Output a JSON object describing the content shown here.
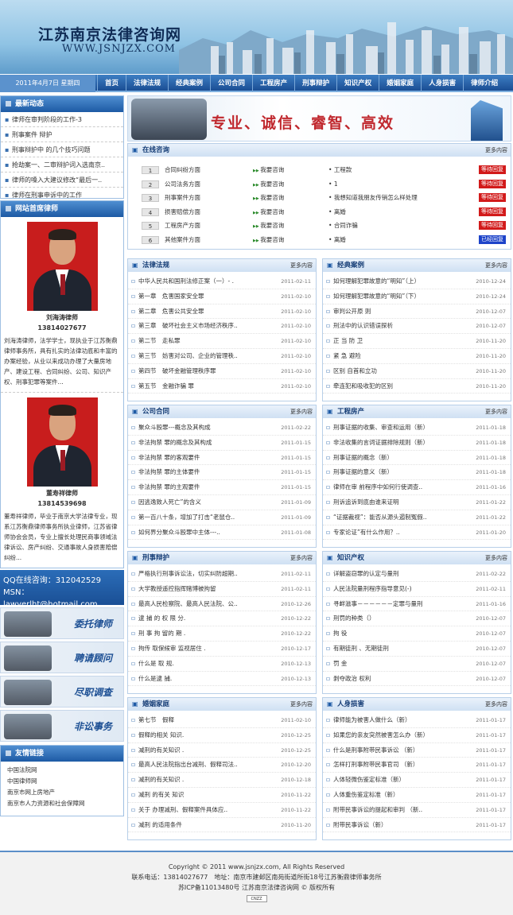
{
  "header": {
    "logo_cn": "江苏南京法律咨询网",
    "logo_url": "WWW.JSNJZX.COM"
  },
  "nav": {
    "date": "2011年4月7日 星期四",
    "items": [
      "首页",
      "法律法规",
      "经典案例",
      "公司合同",
      "工程房产",
      "刑事辩护",
      "知识产权",
      "婚姻家庭",
      "人身损害",
      "律师介绍"
    ]
  },
  "left": {
    "news_title": "最新动态",
    "news": [
      "律师在审判阶段的工作-3",
      "刑事案件 辩护",
      "刑事辩护中 的几个技巧问题",
      "抢劫案一、二审辩护词入选南京..",
      "律师的嗓入大建议修改“最后一..",
      "律师在刑事申诉中的工作"
    ],
    "lawyers_title": "网站首席律师",
    "lawyers": [
      {
        "name": "刘海涛律师",
        "phone": "13814027677",
        "desc": "刘海涛律师，法学学士，现执业于江苏衡鼎律师事务所，具有扎实的法律功底和丰富的办案经验，从业以来成功办理了大量房地产、建设工程、合同纠纷、公司、知识产权、刑事犯罪等案件..."
      },
      {
        "name": "董寿祥律师",
        "phone": "13814539698",
        "desc": "董寿祥律师，毕业于南京大学法律专业，现系江苏衡鼎律师事务所执业律师，江苏省律师协会会员，专业上擅长处理民商事领域法律诉讼、房产纠纷、交通事故人身损害赔偿纠纷..."
      }
    ],
    "qq": "QQ在线咨询：312042529",
    "msn": "MSN：lawyerlht@hotmail.com",
    "services": [
      "委托律师",
      "聘请顾问",
      "尽职调查",
      "非讼事务"
    ],
    "links_title": "友情链接",
    "links": [
      "中国法院网",
      "中国律师网",
      "南京市网上房地产",
      "南京市人力资源和社会保障网"
    ]
  },
  "promo": {
    "slogan": "专业、诚信、睿智、高效"
  },
  "consult": {
    "title": "在线咨询",
    "more": "更多内容",
    "rows": [
      {
        "num": "1",
        "cat": "合同纠纷方面",
        "ask": "我要咨询",
        "q": "工程款",
        "status": "等待回复",
        "done": false
      },
      {
        "num": "2",
        "cat": "公司法务方面",
        "ask": "我要咨询",
        "q": "1",
        "status": "等待回复",
        "done": false
      },
      {
        "num": "3",
        "cat": "刑事案件方面",
        "ask": "我要咨询",
        "q": "我想知道我朋友传销怎么样处理",
        "status": "等待回复",
        "done": false
      },
      {
        "num": "4",
        "cat": "损害赔偿方面",
        "ask": "我要咨询",
        "q": "离婚",
        "status": "等待回复",
        "done": false
      },
      {
        "num": "5",
        "cat": "工程房产方面",
        "ask": "我要咨询",
        "q": "合同诈骗",
        "status": "等待回复",
        "done": false
      },
      {
        "num": "6",
        "cat": "其他案件方面",
        "ask": "我要咨询",
        "q": "离婚",
        "status": "已经回复",
        "done": true
      }
    ]
  },
  "sections": [
    {
      "title": "法律法规",
      "more": "更多内容",
      "items": [
        [
          "中华人民共和国刑法修正案（一）- .",
          "2011-02-11"
        ],
        [
          "第一章　危害国家安全罪",
          "2011-02-10"
        ],
        [
          "第二章　危害公共安全罪",
          "2011-02-10"
        ],
        [
          "第三章　破坏社会主义市场经济秩序..",
          "2011-02-10"
        ],
        [
          "第二节　走私罪",
          "2011-02-10"
        ],
        [
          "第三节　妨害对公司、企业的管理秩..",
          "2011-02-10"
        ],
        [
          "第四节　破坏金融管理秩序罪",
          "2011-02-10"
        ],
        [
          "第五节　金融诈骗 罪",
          "2011-02-10"
        ]
      ]
    },
    {
      "title": "经典案例",
      "more": "更多内容",
      "items": [
        [
          "如何理解犯罪故意的“明知”（上）",
          "2010-12-24"
        ],
        [
          "如何理解犯罪故意的“明知”（下）",
          "2010-12-24"
        ],
        [
          "审判公开原 则",
          "2010-12-07"
        ],
        [
          "刑法中的认识错误探析",
          "2010-12-07"
        ],
        [
          "正 当 防 卫",
          "2010-11-20"
        ],
        [
          "紧 急 避险",
          "2010-11-20"
        ],
        [
          "区别 自首和立功",
          "2010-11-20"
        ],
        [
          "牵连犯和吸收犯的区别",
          "2010-11-20"
        ]
      ]
    },
    {
      "title": "公司合同",
      "more": "更多内容",
      "items": [
        [
          "聚众斗殴罪---概念及其构成",
          "2011-02-22"
        ],
        [
          "非法拘禁 罪的概念及其构成",
          "2011-01-15"
        ],
        [
          "非法拘禁 罪的客观要件",
          "2011-01-15"
        ],
        [
          "非法拘禁 罪的主体要件",
          "2011-01-15"
        ],
        [
          "非法拘禁 罪的主观要件",
          "2011-01-15"
        ],
        [
          "因逃逸致人死亡”的含义",
          "2011-01-09"
        ],
        [
          "第一百八十条，增加了打击“老鼠仓..",
          "2011-01-09"
        ],
        [
          "如何界分聚众斗殴罪中主体---..",
          "2011-01-08"
        ]
      ]
    },
    {
      "title": "工程房产",
      "more": "更多内容",
      "items": [
        [
          "刑事证据的收集、审查和运用（新）",
          "2011-01-18"
        ],
        [
          "非法收集的言词证据排除规则（新）",
          "2011-01-18"
        ],
        [
          "刑事证据的概念（新）",
          "2011-01-18"
        ],
        [
          "刑事证据的意义（新）",
          "2011-01-18"
        ],
        [
          "律师在审 前程序中如何行使调查..",
          "2011-01-16"
        ],
        [
          "刑诉追诉到底由谁来证明",
          "2011-01-22"
        ],
        [
          "“证据裁视”：能否从源头遏制冤假..",
          "2011-01-22"
        ],
        [
          "专家论证”有什么作用？..",
          "2011-01-20"
        ]
      ]
    },
    {
      "title": "刑事辩护",
      "more": "更多内容",
      "items": [
        [
          "严格执行刑事诉讼法，切实纠防超期..",
          "2011-02-11"
        ],
        [
          "大学教授遥控指挥赌博被拘留",
          "2011-02-11"
        ],
        [
          "最高人民检察院、最高人民法院、公..",
          "2010-12-26"
        ],
        [
          "逮 捕 的 权 限 分.",
          "2010-12-22"
        ],
        [
          "刑 事 拘 留的 期 .",
          "2010-12-22"
        ],
        [
          "拘传 取保候审 监视居住 .",
          "2010-12-17"
        ],
        [
          "什么是 取 规.",
          "2010-12-13"
        ],
        [
          "什么是逮 捕.",
          "2010-12-13"
        ]
      ]
    },
    {
      "title": "知识产权",
      "more": "更多内容",
      "items": [
        [
          "详解盗窃罪的认定与量刑",
          "2011-02-22"
        ],
        [
          "人民法院量刑程序指导意见(-)",
          "2011-02-11"
        ],
        [
          "寻衅滋事－－－－－－定罪与量刑",
          "2011-01-16"
        ],
        [
          "刑罚的种类（）",
          "2010-12-07"
        ],
        [
          "拘 役",
          "2010-12-07"
        ],
        [
          "有期徒刑 、无期徒刑",
          "2010-12-07"
        ],
        [
          "罚 金",
          "2010-12-07"
        ],
        [
          "剥夺政治 权利",
          "2010-12-07"
        ]
      ]
    },
    {
      "title": "婚姻家庭",
      "more": "更多内容",
      "items": [
        [
          "第七节　假释",
          "2011-02-10"
        ],
        [
          "假释的相关 知识.",
          "2010-12-25"
        ],
        [
          "减刑的有关知识 .",
          "2010-12-25"
        ],
        [
          "最高人民法院指出台减刑、假释司法..",
          "2010-12-20"
        ],
        [
          "减刑的有关知识 .",
          "2010-12-18"
        ],
        [
          "减刑 的有关 知识",
          "2010-11-22"
        ],
        [
          "关于 办理减刑、假释案件具体应..",
          "2010-11-22"
        ],
        [
          "减刑 的适用条件",
          "2010-11-20"
        ]
      ]
    },
    {
      "title": "人身损害",
      "more": "更多内容",
      "items": [
        [
          "律师能为被害人做什么（新）",
          "2011-01-17"
        ],
        [
          "如果您的亲友突然被害怎么办（新）",
          "2011-01-17"
        ],
        [
          "什么是刑事附带民事诉讼 （新）",
          "2011-01-17"
        ],
        [
          "怎样打刑事附带民事官司 （新）",
          "2011-01-17"
        ],
        [
          "人体轻微伤鉴定标准（新）",
          "2011-01-17"
        ],
        [
          "人体重伤鉴定标准（新）",
          "2011-01-17"
        ],
        [
          "附带民事诉讼的提起和审判 （新..",
          "2011-01-17"
        ],
        [
          "附带民事诉讼（新）",
          "2011-01-17"
        ]
      ]
    }
  ],
  "footer": {
    "copyright": "Copyright © 2011 www.jsnjzx.com, All Rights Reserved",
    "contact": "联系电话：13814027677　地址：南京市建邺区南苑街道所街18号江苏衡鼎律师事务所",
    "icp": "苏ICP备11013480号 江苏南京法律咨询网 © 版权所有",
    "badge": "CNZZ"
  },
  "colors": {
    "brand": "#1d5aa4",
    "alert": "#d21a1a",
    "done": "#1d43c9"
  }
}
